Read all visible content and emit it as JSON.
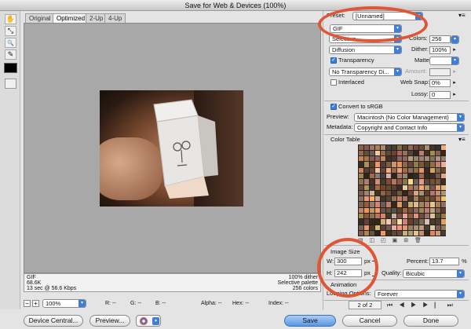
{
  "window": {
    "title": "Save for Web & Devices (100%)"
  },
  "tools": [
    {
      "icon": "hand-icon",
      "glyph": "✋"
    },
    {
      "icon": "slice-select-icon",
      "glyph": "⤡"
    },
    {
      "icon": "zoom-icon",
      "glyph": "🔍"
    },
    {
      "icon": "eyedropper-icon",
      "glyph": "✎"
    }
  ],
  "tabs": [
    "Original",
    "Optimized",
    "2-Up",
    "4-Up"
  ],
  "info": {
    "format": "GIF",
    "size": "68.6K",
    "time": "13 sec @ 56.6 Kbps",
    "dither": "100% dither",
    "palette": "Selective palette",
    "colors": "256 colors"
  },
  "status": {
    "zoom": "100%",
    "r": "R: --",
    "g": "G: --",
    "b": "B: --",
    "alpha": "Alpha: --",
    "hex": "Hex: --",
    "index": "Index: --"
  },
  "settings": {
    "preset_label": "Preset:",
    "preset_value": "[Unnamed]",
    "format": "GIF",
    "reduction": "Selective",
    "colors_label": "Colors:",
    "colors_value": "256",
    "dither_algo": "Diffusion",
    "dither_label": "Dither:",
    "dither_value": "100%",
    "transparency_label": "Transparency",
    "matte_label": "Matte:",
    "transparency_dither": "No Transparency Di...",
    "amount_label": "Amount:",
    "interlaced_label": "Interlaced",
    "websnap_label": "Web Snap:",
    "websnap_value": "0%",
    "lossy_label": "Lossy:",
    "lossy_value": "0",
    "convert_label": "Convert to sRGB",
    "preview_label": "Preview:",
    "preview_value": "Macintosh (No Color Management)",
    "metadata_label": "Metadata:",
    "metadata_value": "Copyright and Contact Info"
  },
  "color_table": {
    "title": "Color Table"
  },
  "image_size": {
    "title": "Image Size",
    "w_label": "W:",
    "w_value": "300",
    "w_unit": "px",
    "h_label": "H:",
    "h_value": "242",
    "h_unit": "px",
    "percent_label": "Percent:",
    "percent_value": "13.7",
    "percent_unit": "%",
    "quality_label": "Quality:",
    "quality_value": "Bicubic"
  },
  "animation": {
    "title": "Animation",
    "looping_label": "Looping Options:",
    "looping_value": "Forever",
    "frame": "2 of 2"
  },
  "buttons": {
    "device_central": "Device Central...",
    "preview": "Preview...",
    "save": "Save",
    "cancel": "Cancel",
    "done": "Done"
  },
  "colors": {
    "accent": "#3f7ed7",
    "highlight_ring": "#e05535"
  }
}
